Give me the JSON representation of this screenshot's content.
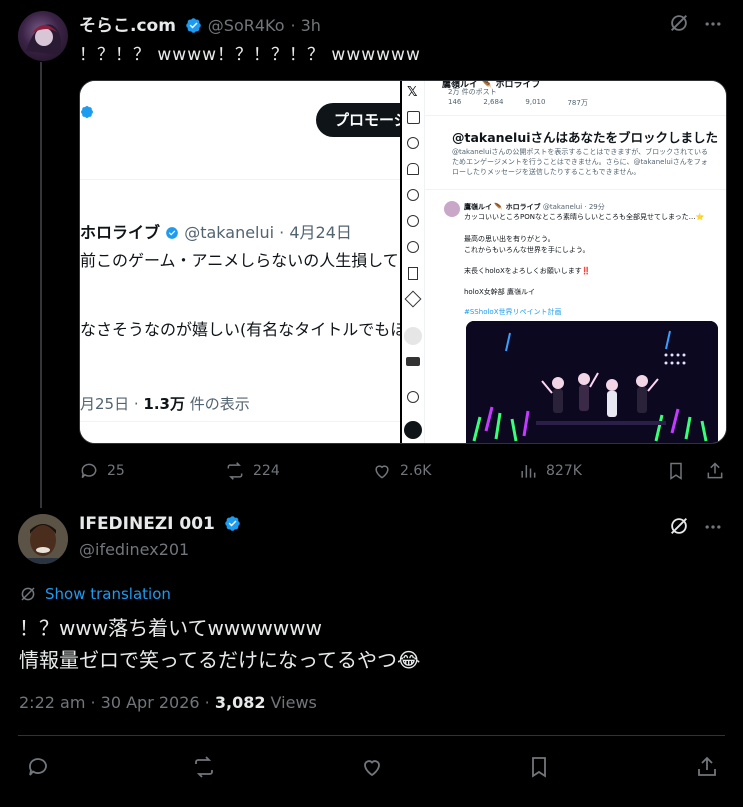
{
  "post1": {
    "display_name": "そらこ.com",
    "handle": "@SoR4Ko",
    "time": "· 3h",
    "text": "！？！？ wwww！？！？！？ wwwwww",
    "actions": {
      "reply": "25",
      "repost": "224",
      "like": "2.6K",
      "views": "827K"
    },
    "media_left": {
      "promo_button": "プロモージ",
      "author": "ホロライブ",
      "author_handle": "@takanelui · 4月24日",
      "line1": "前このゲーム・アニメしらないの人生損して",
      "line2": "なさそうなのが嬉しい(有名なタイトルでもほ",
      "footer_date": "月25日 · ",
      "footer_views": "1.3万",
      "footer_suffix": " 件の表示"
    },
    "media_right": {
      "header_name": "鷹嶺ルイ 🪶 ホロライブ",
      "header_posts": "2万 件のポスト",
      "stats": [
        "146",
        "2,684",
        "9,010",
        "787万"
      ],
      "blocked_title": "@takaneluiさんはあなたをブロックしました",
      "blocked_body": "@takaneluiさんの公開ポストを表示することはできますが、ブロックされているためエンゲージメントを行うことはできません。さらに、@takaneluiさんをフォローしたりメッセージを送信したりすることもできません。",
      "tweet_author": "鷹嶺ルイ 🪶 ホロライブ",
      "tweet_handle": "@takanelui · 29分",
      "tweet_line1": "カッコいいところPONなところ素晴らしいところも全部見せてしまった…⭐",
      "tweet_line2": "最高の思い出を有りがとう。",
      "tweet_line3": "これからもいろんな世界を手にしよう。",
      "tweet_line4": "末長くholoXをよろしくお願いします‼️",
      "tweet_line5": "holoX女幹部 鷹嶺ルイ",
      "tweet_hashtag": "#SSholoX世界リペイント計画"
    }
  },
  "post2": {
    "display_name": "IFEDINEZI 001",
    "handle": "@ifedinex201",
    "translate": "Show translation",
    "line1": "！？www落ち着いてwwwwwww",
    "line2": "情報量ゼロで笑ってるだけになってるやつ😂",
    "time": "2:22 am · 30 Apr 2026 · ",
    "views_count": "3,082",
    "views_label": " Views"
  },
  "colors": {
    "background": "#000000",
    "text": "#e7e9ea",
    "muted": "#71767b",
    "accent": "#1d9bf0",
    "verified": "#1d9bf0"
  },
  "icons": [
    "grok-icon",
    "more-icon",
    "reply-icon",
    "repost-icon",
    "like-icon",
    "views-icon",
    "bookmark-icon",
    "share-icon",
    "translate-icon",
    "verified-icon"
  ]
}
